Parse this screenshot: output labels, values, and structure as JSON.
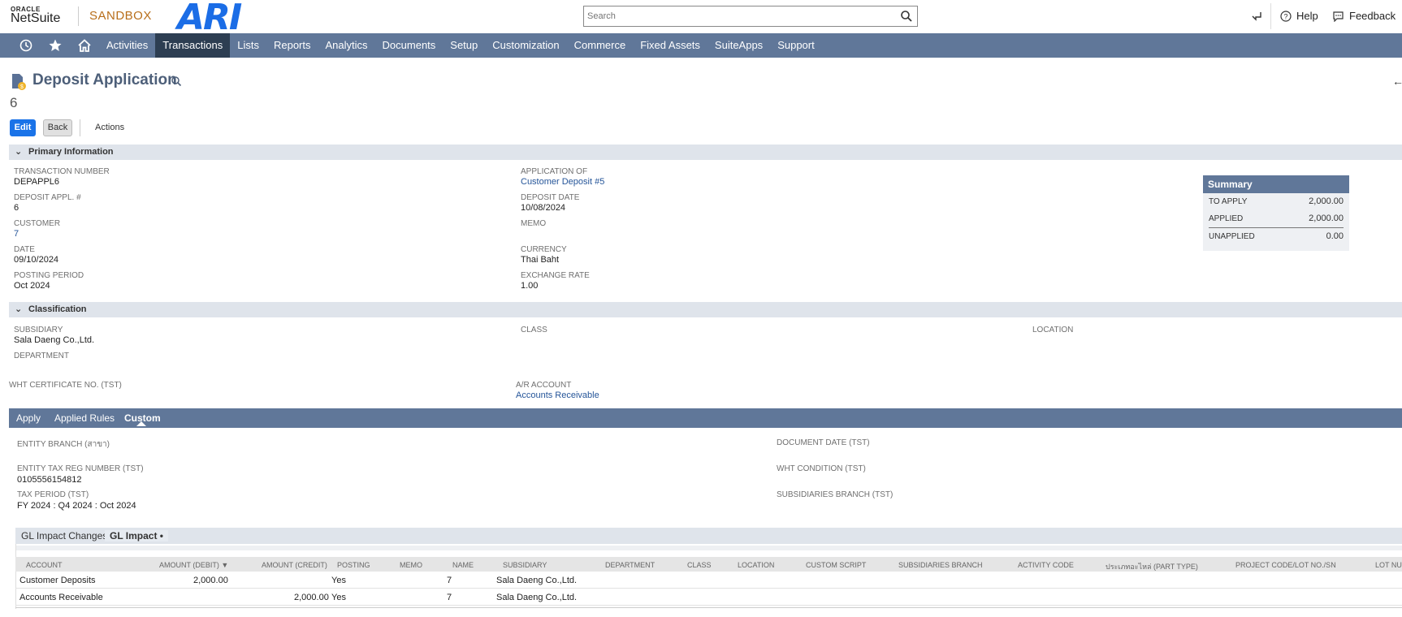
{
  "header": {
    "oracle": "ORACLE",
    "netsuite": "NetSuite",
    "environment": "SANDBOX",
    "company_logo_text": "ARI",
    "search_placeholder": "Search",
    "help": "Help",
    "feedback": "Feedback"
  },
  "nav": {
    "items": [
      "Activities",
      "Transactions",
      "Lists",
      "Reports",
      "Analytics",
      "Documents",
      "Setup",
      "Customization",
      "Commerce",
      "Fixed Assets",
      "SuiteApps",
      "Support"
    ],
    "active": "Transactions"
  },
  "page": {
    "title": "Deposit Application",
    "record_number": "6",
    "buttons": {
      "edit": "Edit",
      "back": "Back",
      "actions": "Actions"
    }
  },
  "primary": {
    "section_title": "Primary Information",
    "transaction_number": {
      "label": "TRANSACTION NUMBER",
      "value": "DEPAPPL6"
    },
    "deposit_appl": {
      "label": "DEPOSIT APPL. #",
      "value": "6"
    },
    "customer": {
      "label": "CUSTOMER",
      "value": "7"
    },
    "date": {
      "label": "DATE",
      "value": "09/10/2024"
    },
    "posting_period": {
      "label": "POSTING PERIOD",
      "value": "Oct 2024"
    },
    "application_of": {
      "label": "APPLICATION OF",
      "value": "Customer Deposit #5"
    },
    "deposit_date": {
      "label": "DEPOSIT DATE",
      "value": "10/08/2024"
    },
    "memo": {
      "label": "MEMO",
      "value": ""
    },
    "currency": {
      "label": "CURRENCY",
      "value": "Thai Baht"
    },
    "exchange_rate": {
      "label": "EXCHANGE RATE",
      "value": "1.00"
    }
  },
  "summary": {
    "title": "Summary",
    "to_apply": {
      "label": "TO APPLY",
      "value": "2,000.00"
    },
    "applied": {
      "label": "APPLIED",
      "value": "2,000.00"
    },
    "unapplied": {
      "label": "UNAPPLIED",
      "value": "0.00"
    }
  },
  "classification": {
    "section_title": "Classification",
    "subsidiary": {
      "label": "SUBSIDIARY",
      "value": "Sala Daeng Co.,Ltd."
    },
    "class": {
      "label": "CLASS",
      "value": ""
    },
    "location": {
      "label": "LOCATION",
      "value": ""
    },
    "department": {
      "label": "DEPARTMENT",
      "value": ""
    }
  },
  "extra": {
    "wht_cert": {
      "label": "WHT CERTIFICATE NO. (TST)",
      "value": ""
    },
    "ar_account": {
      "label": "A/R ACCOUNT",
      "value": "Accounts Receivable"
    }
  },
  "subtabs": {
    "apply": "Apply",
    "applied_rules": "Applied Rules",
    "custom": "Custom"
  },
  "custom": {
    "entity_branch": {
      "label": "ENTITY BRANCH (สาขา)",
      "value": ""
    },
    "entity_tax_reg": {
      "label": "ENTITY TAX REG NUMBER (TST)",
      "value": "0105556154812"
    },
    "tax_period": {
      "label": "TAX PERIOD (TST)",
      "value": "FY 2024 : Q4 2024 : Oct 2024"
    },
    "document_date": {
      "label": "DOCUMENT DATE (TST)",
      "value": ""
    },
    "wht_condition": {
      "label": "WHT CONDITION (TST)",
      "value": ""
    },
    "subsidiaries_branch": {
      "label": "SUBSIDIARIES BRANCH (TST)",
      "value": ""
    }
  },
  "gl": {
    "tab_changes": "GL Impact Changes",
    "tab_impact": "GL Impact •",
    "columns": [
      "ACCOUNT",
      "AMOUNT (DEBIT) ▼",
      "AMOUNT (CREDIT)",
      "POSTING",
      "MEMO",
      "NAME",
      "SUBSIDIARY",
      "DEPARTMENT",
      "CLASS",
      "LOCATION",
      "CUSTOM SCRIPT",
      "SUBSIDIARIES BRANCH",
      "ACTIVITY CODE",
      "ประเภทอะไหล่ (PART TYPE)",
      "PROJECT CODE/LOT NO./SN",
      "LOT NUM"
    ],
    "rows": [
      {
        "account": "Customer Deposits",
        "debit": "2,000.00",
        "credit": "",
        "posting": "Yes",
        "memo": "",
        "name": "7",
        "subsidiary": "Sala Daeng Co.,Ltd."
      },
      {
        "account": "Accounts Receivable",
        "debit": "",
        "credit": "2,000.00",
        "posting": "Yes",
        "memo": "",
        "name": "7",
        "subsidiary": "Sala Daeng Co.,Ltd."
      }
    ]
  }
}
